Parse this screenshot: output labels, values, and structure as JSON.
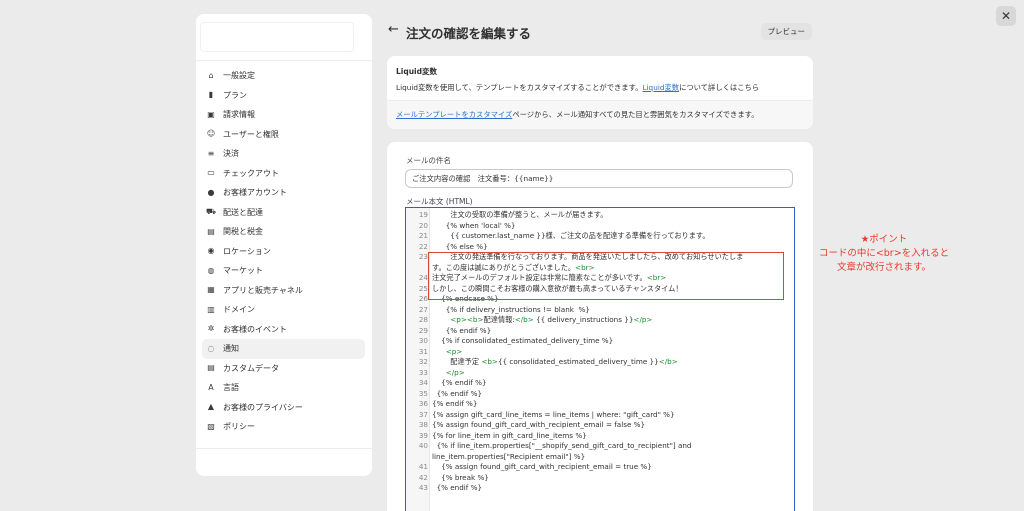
{
  "window": {
    "close_icon": "close-icon"
  },
  "sidebar": {
    "items": [
      {
        "label": "一般設定",
        "icon": "store-icon"
      },
      {
        "label": "プラン",
        "icon": "plan-icon"
      },
      {
        "label": "請求情報",
        "icon": "billing-icon"
      },
      {
        "label": "ユーザーと権限",
        "icon": "users-icon"
      },
      {
        "label": "決済",
        "icon": "payments-icon"
      },
      {
        "label": "チェックアウト",
        "icon": "checkout-icon"
      },
      {
        "label": "お客様アカウント",
        "icon": "customer-icon"
      },
      {
        "label": "配送と配達",
        "icon": "truck-icon"
      },
      {
        "label": "関税と税金",
        "icon": "tax-icon"
      },
      {
        "label": "ロケーション",
        "icon": "location-icon"
      },
      {
        "label": "マーケット",
        "icon": "globe-icon"
      },
      {
        "label": "アプリと販売チャネル",
        "icon": "apps-icon"
      },
      {
        "label": "ドメイン",
        "icon": "domain-icon"
      },
      {
        "label": "お客様のイベント",
        "icon": "events-icon"
      },
      {
        "label": "通知",
        "icon": "bell-icon"
      },
      {
        "label": "カスタムデータ",
        "icon": "data-icon"
      },
      {
        "label": "言語",
        "icon": "language-icon"
      },
      {
        "label": "お客様のプライバシー",
        "icon": "lock-icon"
      },
      {
        "label": "ポリシー",
        "icon": "policy-icon"
      }
    ],
    "active_index": 14
  },
  "header": {
    "back_icon": "arrow-left-icon",
    "title": "注文の確認を編集する",
    "preview_label": "プレビュー"
  },
  "liquid_card": {
    "title": "Liquid変数",
    "desc_prefix": "Liquid変数を使用して、テンプレートをカスタマイズすることができます。",
    "desc_link": "Liquid変数",
    "desc_suffix": "について詳しくはこちら",
    "foot_link": "メールテンプレートをカスタマイズ",
    "foot_text": "ページから、メール通知すべての見た目と雰囲気をカスタマイズできます。"
  },
  "email_card": {
    "subject_label": "メールの件名",
    "subject_value": "ご注文内容の確認　注文番号：{{name}}",
    "body_label": "メール本文 (HTML)"
  },
  "code_lines": [
    {
      "n": "19",
      "t": "        注文の受取の準備が整うと、メールが届きます。"
    },
    {
      "n": "20",
      "t": "      {% when 'local' %}"
    },
    {
      "n": "21",
      "t": "        {{ customer.last_name }}様、ご注文の品を配達する準備を行っております。"
    },
    {
      "n": "22",
      "t": "      {% else %}"
    },
    {
      "n": "23",
      "t": "        注文の発送準備を行なっております。商品を発送いたしましたら、改めてお知らせいたしま",
      "tag": "<br>",
      "cont": "す。この度は誠にありがとうございました。"
    },
    {
      "n": "24",
      "t": "注文完了メールのデフォルト設定は非常に簡素なことが多いです。",
      "tag": "<br>"
    },
    {
      "n": "25",
      "t": "しかし、この瞬間こそお客様の購入意欲が最も高まっているチャンスタイム！"
    },
    {
      "n": "26",
      "t": "    {% endcase %}"
    },
    {
      "n": "27",
      "t": "      {% if delivery_instructions != blank  %}"
    },
    {
      "n": "28",
      "t": "        <p><b>配達情報:</b> {{ delivery_instructions }}</p>"
    },
    {
      "n": "29",
      "t": "      {% endif %}"
    },
    {
      "n": "30",
      "t": "    {% if consolidated_estimated_delivery_time %}"
    },
    {
      "n": "31",
      "t": "      <p>"
    },
    {
      "n": "32",
      "t": "        配達予定 <b>{{ consolidated_estimated_delivery_time }}</b>"
    },
    {
      "n": "33",
      "t": "      </p>"
    },
    {
      "n": "34",
      "t": "    {% endif %}"
    },
    {
      "n": "35",
      "t": "  {% endif %}"
    },
    {
      "n": "36",
      "t": "{% endif %}"
    },
    {
      "n": "37",
      "t": "{% assign gift_card_line_items = line_items | where: \"gift_card\" %}"
    },
    {
      "n": "38",
      "t": "{% assign found_gift_card_with_recipient_email = false %}"
    },
    {
      "n": "39",
      "t": "{% for line_item in gift_card_line_items %}"
    },
    {
      "n": "40",
      "t": "  {% if line_item.properties[\"__shopify_send_gift_card_to_recipient\"] and",
      "cont": "line_item.properties[\"Recipient email\"] %}"
    },
    {
      "n": "41",
      "t": "    {% assign found_gift_card_with_recipient_email = true %}"
    },
    {
      "n": "42",
      "t": "    {% break %}"
    },
    {
      "n": "43",
      "t": "  {% endif %}"
    }
  ],
  "annotation": {
    "line1": "★ポイント",
    "line2": "コードの中に<br>を入れると",
    "line3": "文章が改行されます。"
  }
}
